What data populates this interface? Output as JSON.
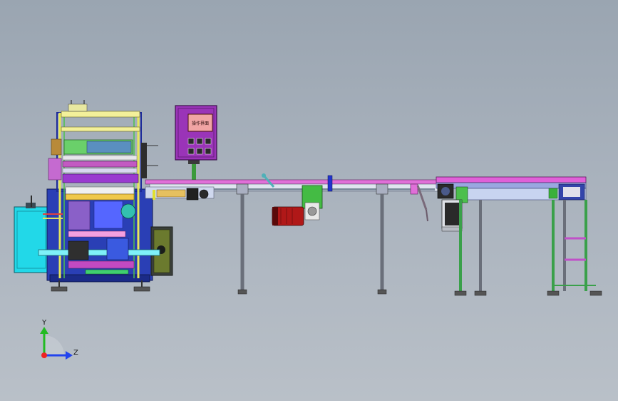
{
  "panel": {
    "screen_text": "操作界面"
  },
  "triad": {
    "y_label": "Y",
    "z_label": "Z"
  },
  "colors": {
    "background_top": "#9aa5b1",
    "background_bottom": "#b9c0c8",
    "frame_blue": "#2233aa",
    "panel_purple": "#8a2aa0",
    "conveyor_magenta": "#d04fd0",
    "cyan_box": "#22d8e8",
    "motor_red": "#b01818",
    "gearbox_green": "#33aa33",
    "axis_y": "#22bb22",
    "axis_z": "#2244ee",
    "axis_x": "#ee2222"
  }
}
